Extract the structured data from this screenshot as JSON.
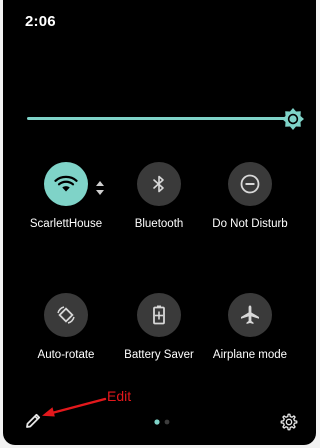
{
  "status_bar": {
    "time": "2:06"
  },
  "brightness": {
    "level": 1.0
  },
  "tiles": [
    {
      "label": "ScarlettHouse",
      "icon": "wifi-icon",
      "active": true
    },
    {
      "label": "Bluetooth",
      "icon": "bluetooth-icon",
      "active": false
    },
    {
      "label": "Do Not Disturb",
      "icon": "do-not-disturb-icon",
      "active": false
    },
    {
      "label": "Auto-rotate",
      "icon": "auto-rotate-icon",
      "active": false
    },
    {
      "label": "Battery Saver",
      "icon": "battery-saver-icon",
      "active": false
    },
    {
      "label": "Airplane mode",
      "icon": "airplane-icon",
      "active": false
    }
  ],
  "footer": {
    "annotation": "Edit",
    "page_indicator": {
      "current": 1,
      "total": 2
    }
  },
  "colors": {
    "accent": "#7fd3c8",
    "tile_inactive": "#3a3a3a",
    "background": "#000000",
    "annotation": "#e3181c"
  }
}
